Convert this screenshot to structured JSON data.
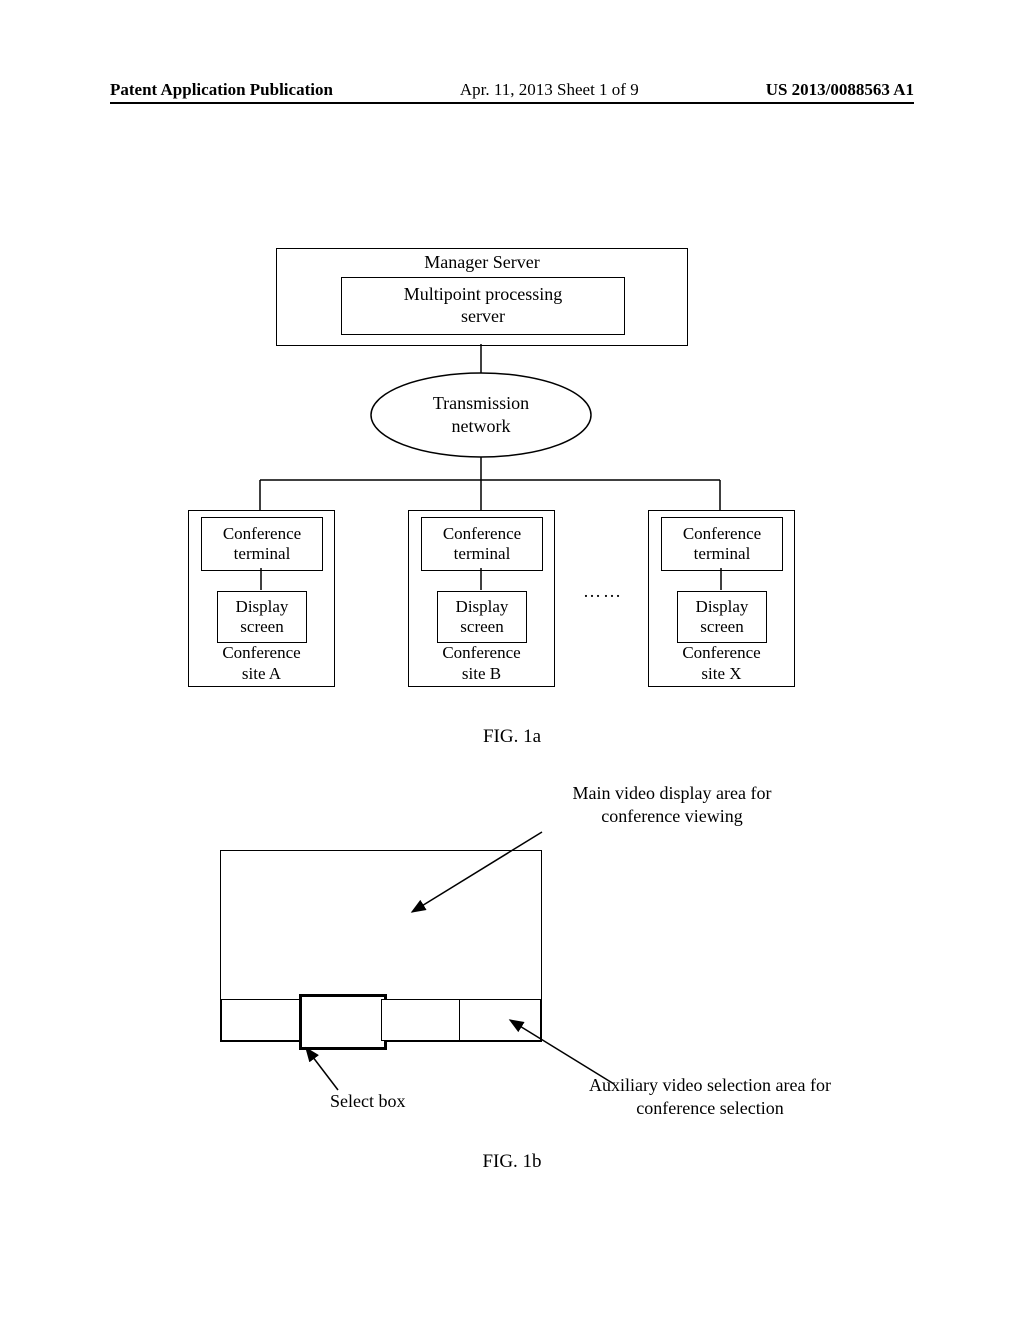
{
  "header": {
    "left": "Patent Application Publication",
    "mid": "Apr. 11, 2013  Sheet 1 of 9",
    "right": "US 2013/0088563 A1"
  },
  "fig1a": {
    "manager_server": "Manager Server",
    "multipoint": "Multipoint processing\nserver",
    "transmission": "Transmission\nnetwork",
    "conf_terminal": "Conference\nterminal",
    "display_screen": "Display\nscreen",
    "site_a": "Conference\nsite A",
    "site_b": "Conference\nsite B",
    "site_x": "Conference\nsite X",
    "ellipsis": "……",
    "caption": "FIG. 1a"
  },
  "fig1b": {
    "main_label": "Main video display area for\nconference viewing",
    "aux_label": "Auxiliary video selection area for\nconference selection",
    "select_box": "Select box",
    "caption": "FIG. 1b"
  }
}
